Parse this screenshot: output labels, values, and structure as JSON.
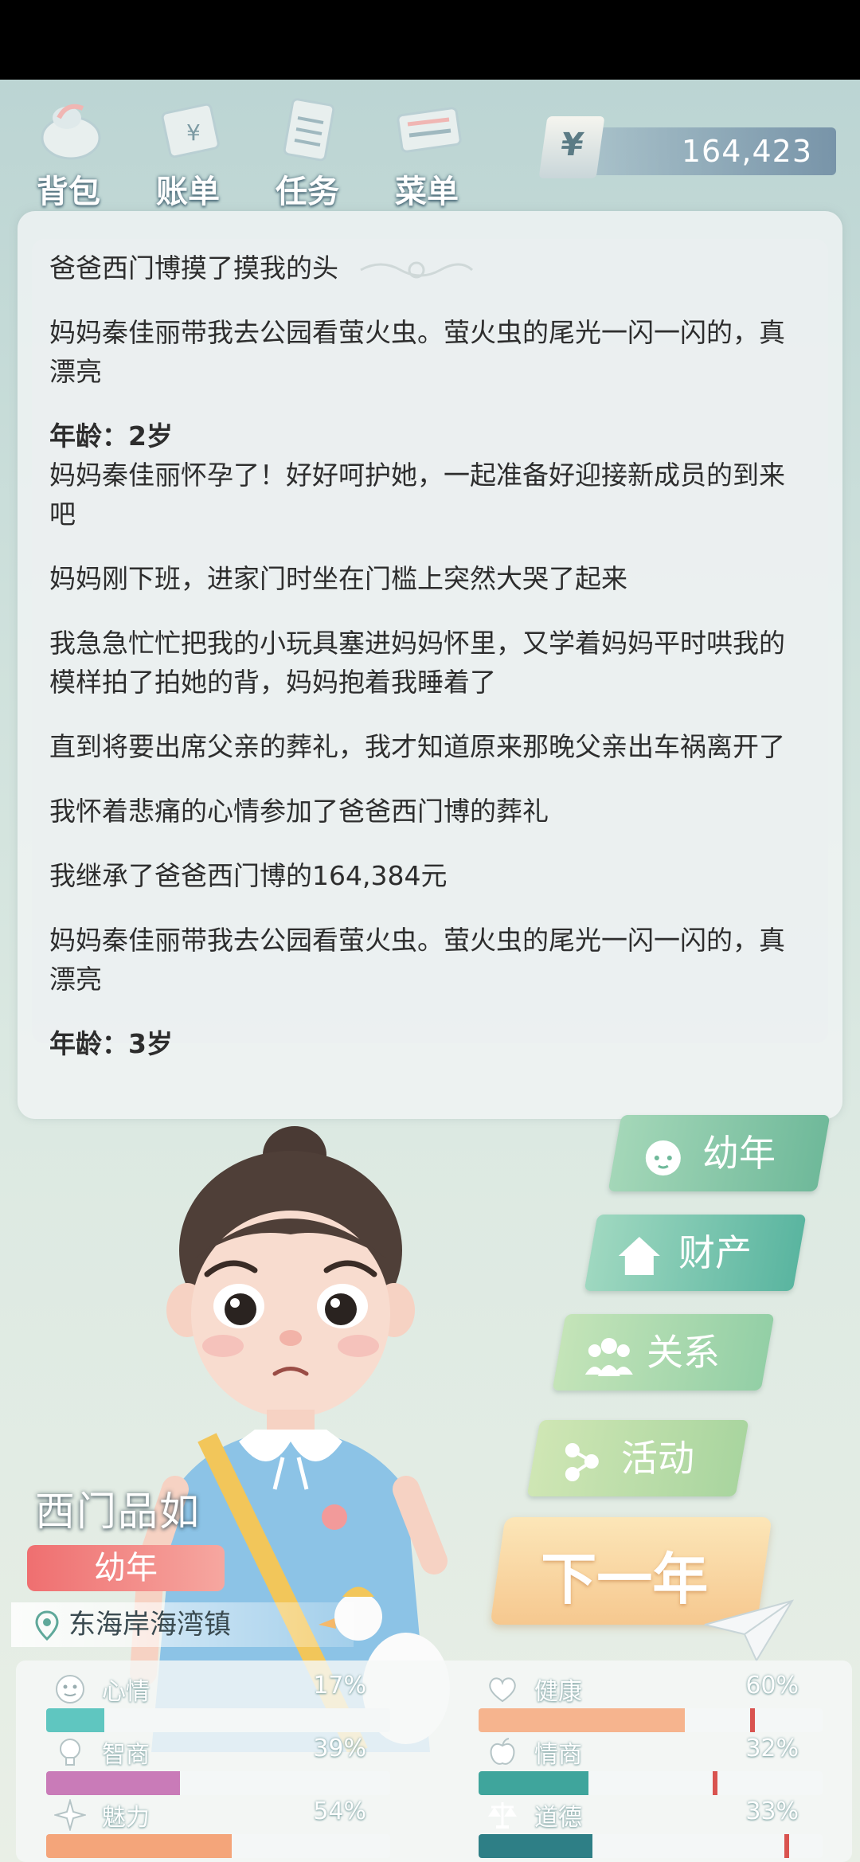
{
  "topbar": {
    "menu": [
      {
        "label": "背包",
        "icon": "bag-icon"
      },
      {
        "label": "账单",
        "icon": "bill-icon"
      },
      {
        "label": "任务",
        "icon": "task-icon"
      },
      {
        "label": "菜单",
        "icon": "menu-icon"
      }
    ],
    "money_symbol": "¥",
    "money_amount": "164,423"
  },
  "log": {
    "entries": [
      {
        "text": "爸爸西门博摸了摸我的头",
        "age": false
      },
      {
        "text": "妈妈秦佳丽带我去公园看萤火虫。萤火虫的尾光一闪一闪的，真漂亮",
        "age": false
      },
      {
        "text": "年龄：2岁",
        "age": true
      },
      {
        "text": "妈妈秦佳丽怀孕了！好好呵护她，一起准备好迎接新成员的到来吧",
        "age": false
      },
      {
        "text": "妈妈刚下班，进家门时坐在门槛上突然大哭了起来",
        "age": false
      },
      {
        "text": "我急急忙忙把我的小玩具塞进妈妈怀里，又学着妈妈平时哄我的模样拍了拍她的背，妈妈抱着我睡着了",
        "age": false
      },
      {
        "text": "直到将要出席父亲的葬礼，我才知道原来那晚父亲出车祸离开了",
        "age": false
      },
      {
        "text": "我怀着悲痛的心情参加了爸爸西门博的葬礼",
        "age": false
      },
      {
        "text": "我继承了爸爸西门博的164,384元",
        "age": false
      },
      {
        "text": "妈妈秦佳丽带我去公园看萤火虫。萤火虫的尾光一闪一闪的，真漂亮",
        "age": false
      },
      {
        "text": "年龄：3岁",
        "age": true
      }
    ]
  },
  "character": {
    "name": "西门品如",
    "stage": "幼年",
    "location": "东海岸海湾镇"
  },
  "side_buttons": {
    "youth": "幼年",
    "assets": "财产",
    "relations": "关系",
    "activities": "活动",
    "next_year": "下一年"
  },
  "stats": [
    {
      "label": "心情",
      "value": "17%",
      "fraction": 0.17,
      "color": "#5fc6c0",
      "icon": "mood-icon"
    },
    {
      "label": "健康",
      "value": "60%",
      "fraction": 0.6,
      "color": "#f6b48e",
      "icon": "heart-icon",
      "marker": 0.79
    },
    {
      "label": "智商",
      "value": "39%",
      "fraction": 0.39,
      "color": "#c97bb8",
      "icon": "lightbulb-icon"
    },
    {
      "label": "情商",
      "value": "32%",
      "fraction": 0.32,
      "color": "#3fa59c",
      "icon": "apple-icon",
      "marker": 0.68
    },
    {
      "label": "魅力",
      "value": "54%",
      "fraction": 0.54,
      "color": "#f4a57a",
      "icon": "sparkle-icon"
    },
    {
      "label": "道德",
      "value": "33%",
      "fraction": 0.33,
      "color": "#2e7f86",
      "icon": "scale-icon",
      "marker": 0.89
    }
  ]
}
